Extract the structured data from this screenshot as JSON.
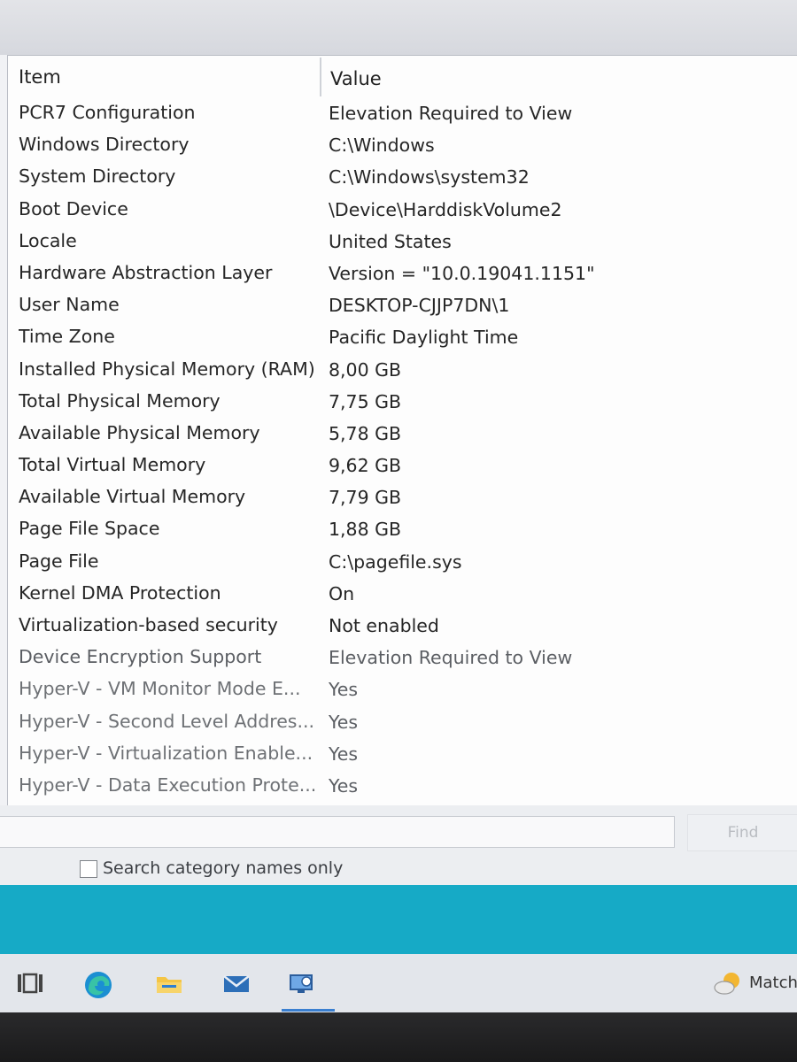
{
  "columns": {
    "item": "Item",
    "value": "Value"
  },
  "rows": [
    {
      "item": "PCR7 Configuration",
      "value": "Elevation Required to View"
    },
    {
      "item": "Windows Directory",
      "value": "C:\\Windows"
    },
    {
      "item": "System Directory",
      "value": "C:\\Windows\\system32"
    },
    {
      "item": "Boot Device",
      "value": "\\Device\\HarddiskVolume2"
    },
    {
      "item": "Locale",
      "value": "United States"
    },
    {
      "item": "Hardware Abstraction Layer",
      "value": "Version = \"10.0.19041.1151\""
    },
    {
      "item": "User Name",
      "value": "DESKTOP-CJJP7DN\\1"
    },
    {
      "item": "Time Zone",
      "value": "Pacific Daylight Time"
    },
    {
      "item": "Installed Physical Memory (RAM)",
      "value": "8,00 GB"
    },
    {
      "item": "Total Physical Memory",
      "value": "7,75 GB"
    },
    {
      "item": "Available Physical Memory",
      "value": "5,78 GB"
    },
    {
      "item": "Total Virtual Memory",
      "value": "9,62 GB"
    },
    {
      "item": "Available Virtual Memory",
      "value": "7,79 GB"
    },
    {
      "item": "Page File Space",
      "value": "1,88 GB"
    },
    {
      "item": "Page File",
      "value": "C:\\pagefile.sys"
    },
    {
      "item": "Kernel DMA Protection",
      "value": "On"
    },
    {
      "item": "Virtualization-based security",
      "value": "Not enabled"
    },
    {
      "item": "Device Encryption Support",
      "value": "Elevation Required to View"
    },
    {
      "item": "Hyper-V - VM Monitor Mode E...",
      "value": "Yes"
    },
    {
      "item": "Hyper-V - Second Level Addres...",
      "value": "Yes"
    },
    {
      "item": "Hyper-V - Virtualization Enable...",
      "value": "Yes"
    },
    {
      "item": "Hyper-V - Data Execution Prote...",
      "value": "Yes"
    }
  ],
  "find": {
    "input_value": "",
    "button_label": "Find"
  },
  "search_category_names_only": {
    "label": "Search category names only",
    "checked": false
  },
  "taskbar": {
    "icons": [
      "task-view-icon",
      "edge-icon",
      "file-explorer-icon",
      "mail-icon",
      "system-information-icon"
    ],
    "weather_text": "Match"
  },
  "colors": {
    "desktop": "#16aac6",
    "accent": "#3a7fd0"
  }
}
